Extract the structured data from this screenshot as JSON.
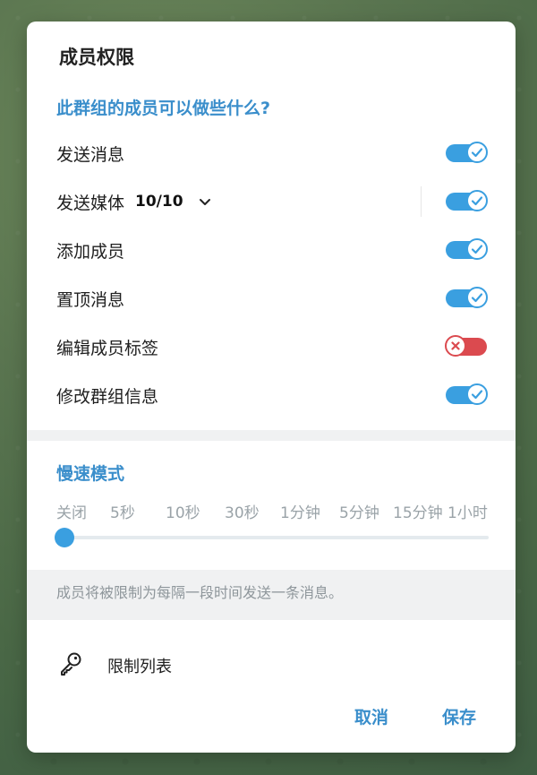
{
  "dialog": {
    "title": "成员权限",
    "permissions_header": "此群组的成员可以做些什么?",
    "permissions": [
      {
        "id": "send-messages",
        "label": "发送消息",
        "enabled": true
      },
      {
        "id": "send-media",
        "label": "发送媒体",
        "count": "10/10",
        "enabled": true
      },
      {
        "id": "add-members",
        "label": "添加成员",
        "enabled": true
      },
      {
        "id": "pin-messages",
        "label": "置顶消息",
        "enabled": true
      },
      {
        "id": "edit-member-tags",
        "label": "编辑成员标签",
        "enabled": false
      },
      {
        "id": "change-group-info",
        "label": "修改群组信息",
        "enabled": true
      }
    ],
    "slow_mode": {
      "header": "慢速模式",
      "options": [
        "关闭",
        "5秒",
        "10秒",
        "30秒",
        "1分钟",
        "5分钟",
        "15分钟",
        "1小时"
      ],
      "selected_index": 0,
      "hint": "成员将被限制为每隔一段时间发送一条消息。"
    },
    "restrictions_label": "限制列表",
    "cancel_label": "取消",
    "save_label": "保存"
  },
  "colors": {
    "accent": "#3a9fe0",
    "header_text": "#3a8ecb",
    "off_red": "#db4a4f"
  },
  "icons": {
    "chevron": "chevron-down-icon",
    "check": "check-icon",
    "cross": "close-icon",
    "key": "key-icon"
  }
}
